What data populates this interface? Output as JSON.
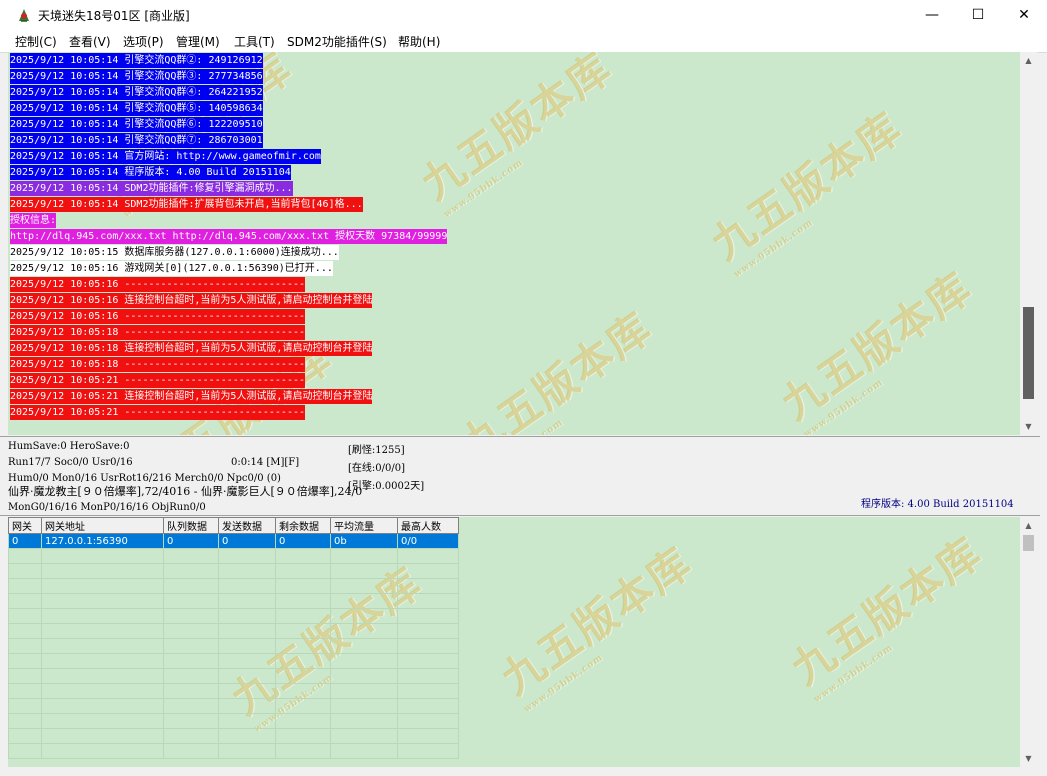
{
  "window": {
    "title": "天境迷失18号01区 [商业版]",
    "minimize_glyph": "—",
    "maximize_glyph": "☐",
    "close_glyph": "✕"
  },
  "menu": [
    {
      "label": "控制(C)"
    },
    {
      "label": "查看(V)"
    },
    {
      "label": "选项(P)"
    },
    {
      "label": "管理(M)"
    },
    {
      "label": "工具(T)"
    },
    {
      "label": "SDM2功能插件(S)"
    },
    {
      "label": "帮助(H)"
    }
  ],
  "colors": {
    "log_bg": "#cce8cc",
    "blue": "#0000f0",
    "purple": "#8a2be2",
    "red": "#f01010",
    "magenta": "#e020e0",
    "selection": "#0078d7"
  },
  "log": [
    {
      "text": "2025/9/12 10:05:14 引擎交流QQ群②: 249126912",
      "color": "blue"
    },
    {
      "text": "2025/9/12 10:05:14 引擎交流QQ群③: 277734856",
      "color": "blue"
    },
    {
      "text": "2025/9/12 10:05:14 引擎交流QQ群④: 264221952",
      "color": "blue"
    },
    {
      "text": "2025/9/12 10:05:14 引擎交流QQ群⑤: 140598634",
      "color": "blue"
    },
    {
      "text": "2025/9/12 10:05:14 引擎交流QQ群⑥: 122209510",
      "color": "blue"
    },
    {
      "text": "2025/9/12 10:05:14 引擎交流QQ群⑦: 286703001",
      "color": "blue"
    },
    {
      "text": "2025/9/12 10:05:14 官方网站: http://www.gameofmir.com",
      "color": "blue"
    },
    {
      "text": "2025/9/12 10:05:14 程序版本: 4.00 Build 20151104",
      "color": "blue"
    },
    {
      "text": "2025/9/12 10:05:14 SDM2功能插件:修复引擎漏洞成功...",
      "color": "purple"
    },
    {
      "text": "2025/9/12 10:05:14 SDM2功能插件:扩展背包未开启,当前背包[46]格...",
      "color": "red"
    },
    {
      "text": "授权信息:",
      "color": "magenta"
    },
    {
      "text": "http://dlq.945.com/xxx.txt http://dlq.945.com/xxx.txt 授权天数 97384/99999",
      "color": "magenta"
    },
    {
      "text": "2025/9/12 10:05:15 数据库服务器(127.0.0.1:6000)连接成功...",
      "color": "white"
    },
    {
      "text": "2025/9/12 10:05:16 游戏网关[0](127.0.0.1:56390)已打开...",
      "color": "white"
    },
    {
      "text": "2025/9/12 10:05:16 ------------------------------",
      "color": "red"
    },
    {
      "text": "2025/9/12 10:05:16 连接控制台超时,当前为5人测试版,请启动控制台并登陆",
      "color": "red"
    },
    {
      "text": "2025/9/12 10:05:16 ------------------------------",
      "color": "red"
    },
    {
      "text": "2025/9/12 10:05:18 ------------------------------",
      "color": "red"
    },
    {
      "text": "2025/9/12 10:05:18 连接控制台超时,当前为5人测试版,请启动控制台并登陆",
      "color": "red"
    },
    {
      "text": "2025/9/12 10:05:18 ------------------------------",
      "color": "red"
    },
    {
      "text": "2025/9/12 10:05:21 ------------------------------",
      "color": "red"
    },
    {
      "text": "2025/9/12 10:05:21 连接控制台超时,当前为5人测试版,请启动控制台并登陆",
      "color": "red"
    },
    {
      "text": "2025/9/12 10:05:21 ------------------------------",
      "color": "red"
    }
  ],
  "status": {
    "save_line": "HumSave:0 HeroSave:0",
    "run_line": "Run17/7 Soc0/0 Usr0/16",
    "uptime": "0:0:14 [M][F]",
    "refresh": "[刷怪:1255]",
    "online": "[在线:0/0/0]",
    "engine": "[引擎:0.0002天]",
    "hum_line": "Hum0/0 Mon0/16 UsrRot16/216 Merch0/0 Npc0/0 (0)",
    "boss_line": "仙界·魔龙教主[９０倍爆率],72/4016 - 仙界·魔影巨人[９０倍爆率],24/0",
    "mon_line": "MonG0/16/16 MonP0/16/16 ObjRun0/0",
    "version": "程序版本: 4.00 Build 20151104"
  },
  "gateway_table": {
    "headers": [
      "网关",
      "网关地址",
      "队列数据",
      "发送数据",
      "剩余数据",
      "平均流量",
      "最高人数"
    ],
    "rows": [
      [
        "0",
        "127.0.0.1:56390",
        "0",
        "0",
        "0",
        "0b",
        "0/0"
      ]
    ]
  },
  "watermark": {
    "text": "九五版本库",
    "url": "www.95bbk.com"
  },
  "scrollbar": {
    "up_glyph": "▲",
    "down_glyph": "▼"
  }
}
